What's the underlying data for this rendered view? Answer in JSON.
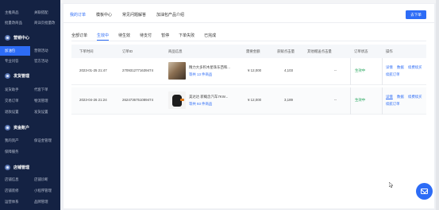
{
  "sidebar": {
    "top_rows": [
      {
        "left": "主推商品",
        "right": "关联搭配"
      },
      {
        "left": "批量改商品",
        "right": "商详页批量改"
      }
    ],
    "sections": [
      {
        "title": "营销中心",
        "items": [
          {
            "left": "加油包",
            "right": "营销活动",
            "left_active": true
          },
          {
            "left": "专业问答",
            "right": "官方活动"
          }
        ]
      },
      {
        "title": "发货管理",
        "items": [
          {
            "left": "发货助手",
            "right": "代客下单"
          },
          {
            "left": "交易订单",
            "right": "物流管理"
          },
          {
            "left": "退款设置",
            "right": "发货设置"
          }
        ]
      },
      {
        "title": "资金账户",
        "items": [
          {
            "left": "我的资产",
            "right": "保证金管理"
          },
          {
            "left": "保障服务",
            "right": ""
          }
        ]
      },
      {
        "title": "店铺管理",
        "items": [
          {
            "left": "店铺信息",
            "right": "店铺诊断"
          },
          {
            "left": "店铺装修",
            "right": "小程序管理"
          },
          {
            "left": "运营体系",
            "right": "品牌管理"
          }
        ]
      }
    ]
  },
  "header": {
    "tabs": [
      "我的订单",
      "模板中心",
      "常见问题解答",
      "加油包产品介绍"
    ],
    "active_tab": 0,
    "place_order_label": "去下单"
  },
  "filters": {
    "tabs": [
      "全部订单",
      "生效中",
      "待生效",
      "待支付",
      "暂停",
      "下单失败",
      "已完成"
    ],
    "active_tab": 1
  },
  "table": {
    "columns": [
      "下单时间",
      "订单ID",
      "商品信息",
      "需要金额",
      "获赋点击量",
      "其他赠送点击量",
      "订单状态",
      "操作"
    ],
    "rows": [
      {
        "time": "2023-01-25 21:47",
        "order_id": "2709312771639474",
        "product_name": "精力大多积木星珠东西和...",
        "product_count": "等共 13 件商品",
        "amount": "¥ 12,000",
        "clicks": "4,103",
        "bonus": "--",
        "status": "生效中",
        "actions": [
          "详情",
          "数据",
          "续费续买"
        ],
        "actions2": [
          "续航订单"
        ]
      },
      {
        "time": "2023-04-26 21:24",
        "order_id": "2624736751089474",
        "product_name": "美达达 新概念汽车7KW...",
        "product_count": "等共 93 件商品",
        "amount": "¥ 12,000",
        "clicks": "3,189",
        "bonus": "--",
        "status": "生效中",
        "actions": [
          "详情",
          "数据",
          "续费续买"
        ],
        "actions2": [
          "续航订单"
        ]
      }
    ]
  },
  "colors": {
    "sidebar_bg": "#142243",
    "accent": "#2d6cf6",
    "status_green": "#22a55a"
  },
  "icons": {
    "help": "envelope-icon",
    "cursor": "mouse-cursor-icon"
  }
}
